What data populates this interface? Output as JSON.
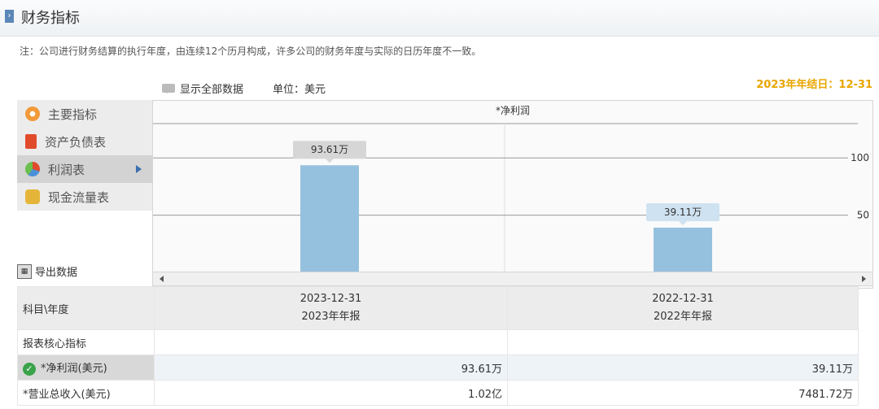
{
  "header": {
    "title": "财务指标"
  },
  "note": "注：公司进行财务结算的执行年度，由连续12个历月构成，许多公司的财务年度与实际的日历年度不一致。",
  "toolbar": {
    "show_all": "显示全部数据",
    "unit": "单位：美元"
  },
  "fiscal_year_end": "2023年年结日：12-31",
  "sidenav": {
    "items": [
      {
        "label": "主要指标",
        "icon": "gear-icon"
      },
      {
        "label": "资产负债表",
        "icon": "document-icon"
      },
      {
        "label": "利润表",
        "icon": "pie-chart-icon",
        "active": true
      },
      {
        "label": "现金流量表",
        "icon": "coins-icon"
      }
    ]
  },
  "export_label": "导出数据",
  "chart_data": {
    "type": "bar",
    "title": "*净利润",
    "categories": [
      "2023-12-31",
      "2022-12-31"
    ],
    "values": [
      93.61,
      39.11
    ],
    "value_labels": [
      "93.61万",
      "39.11万"
    ],
    "y_ticks": [
      "100",
      "50"
    ],
    "ylim": [
      0,
      130
    ],
    "grid": true,
    "bar_color": "#96c1de"
  },
  "table": {
    "header_label": "科目\\年度",
    "columns": [
      {
        "date": "2023-12-31",
        "report": "2023年年报"
      },
      {
        "date": "2022-12-31",
        "report": "2022年年报"
      }
    ],
    "section": "报表核心指标",
    "rows": [
      {
        "label": "*净利润(美元)",
        "values": [
          "93.61万",
          "39.11万"
        ]
      },
      {
        "label": "*营业总收入(美元)",
        "values": [
          "1.02亿",
          "7481.72万"
        ]
      }
    ]
  }
}
